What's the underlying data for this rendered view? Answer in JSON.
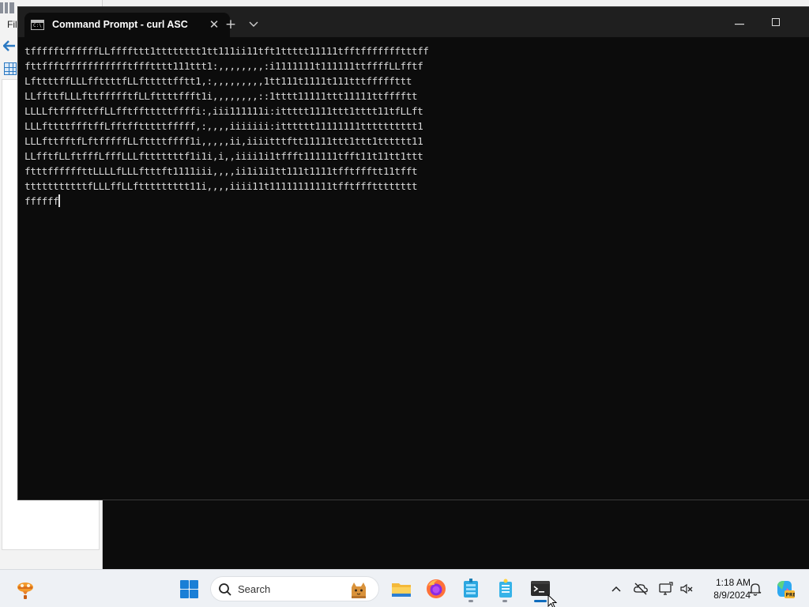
{
  "desktop": {
    "explorer_menu_label": "Fil"
  },
  "terminal": {
    "tab_title": "Command Prompt - curl  ASC",
    "new_tab_symbol": "+",
    "dropdown_symbol": "⌄",
    "close_tab_symbol": "✕",
    "controls": {
      "minimize": "—",
      "close": "✕"
    },
    "output_lines": [
      "tffffftffffffLLffffttt1tttttttt1tt111ii11tft1ttttt11111tfftffffffftttff",
      "fttffftffffffffffftffftttt111ttt1:,,,,,,,,:i1111111t111111ttffffLLfftf",
      "LfttttffLLLffttttfLLftttttfftt1,:,,,,,,,,,1tt111t1111t111tttfffffttt",
      "LLffttfLLLfttffffftfLLfttttffft1i,,,,,,,,::1tttt11111ttt11111ttfffftt",
      "LLLLftffffttffLLfftfftttttffffi:,iii111111i:ittttt1111ttt1tttt11tfLLft",
      "LLLfttttffftffLfftfftttttfffff,:,,,,iiiiiii:itttttt11111111tttttttttt1",
      "LLLfttfftfLftfffffLLfttttffff1i,,,,,ii,iiiitttftt11111ttt1ttt1tttttt11",
      "LLfftfLLftfffLfffLLLftttttttf1i1i,i,,iiii1i1tffft111111tfft11t11tt1ttt",
      "ftttffffffttLLLLfLLLftttft1111iii,,,,ii1i1i1tt111t1111tfftffftt11tfft",
      "tttttttttttfLLLffLLfttttttttt11i,,,,iiii11t11111111111tfftffftttttttt",
      "ffffff"
    ]
  },
  "taskbar": {
    "search_label": "Search",
    "clock_time": "1:18 AM",
    "clock_date": "8/9/2024",
    "tray_chevron": "^"
  },
  "colors": {
    "terminal_background": "#0c0c0c",
    "terminal_text": "#d9d9d9",
    "titlebar": "#1f1f1f",
    "taskbar": "#eef1f5",
    "accent": "#0f6cbd"
  }
}
